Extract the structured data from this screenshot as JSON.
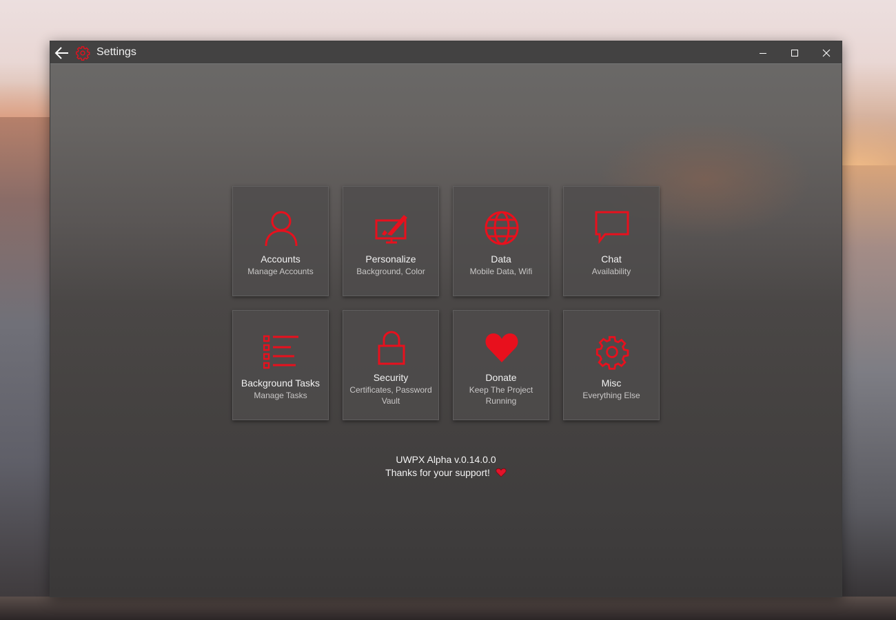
{
  "window": {
    "title": "Settings"
  },
  "tiles": [
    {
      "label": "Accounts",
      "subtitle": "Manage Accounts",
      "icon": "user-icon"
    },
    {
      "label": "Personalize",
      "subtitle": "Background, Color",
      "icon": "personalize-icon"
    },
    {
      "label": "Data",
      "subtitle": "Mobile Data, Wifi",
      "icon": "globe-icon"
    },
    {
      "label": "Chat",
      "subtitle": "Availability",
      "icon": "chat-bubble-icon"
    },
    {
      "label": "Background Tasks",
      "subtitle": "Manage Tasks",
      "icon": "task-list-icon"
    },
    {
      "label": "Security",
      "subtitle": "Certificates, Password Vault",
      "icon": "lock-icon"
    },
    {
      "label": "Donate",
      "subtitle": "Keep The Project Running",
      "icon": "heart-icon"
    },
    {
      "label": "Misc",
      "subtitle": "Everything Else",
      "icon": "gear-icon"
    }
  ],
  "footer": {
    "version": "UWPX Alpha v.0.14.0.0",
    "thanks": "Thanks for your support!"
  },
  "colors": {
    "accent": "#e8101d",
    "titlebar": "#434242",
    "tile": "#4e4c4c"
  }
}
